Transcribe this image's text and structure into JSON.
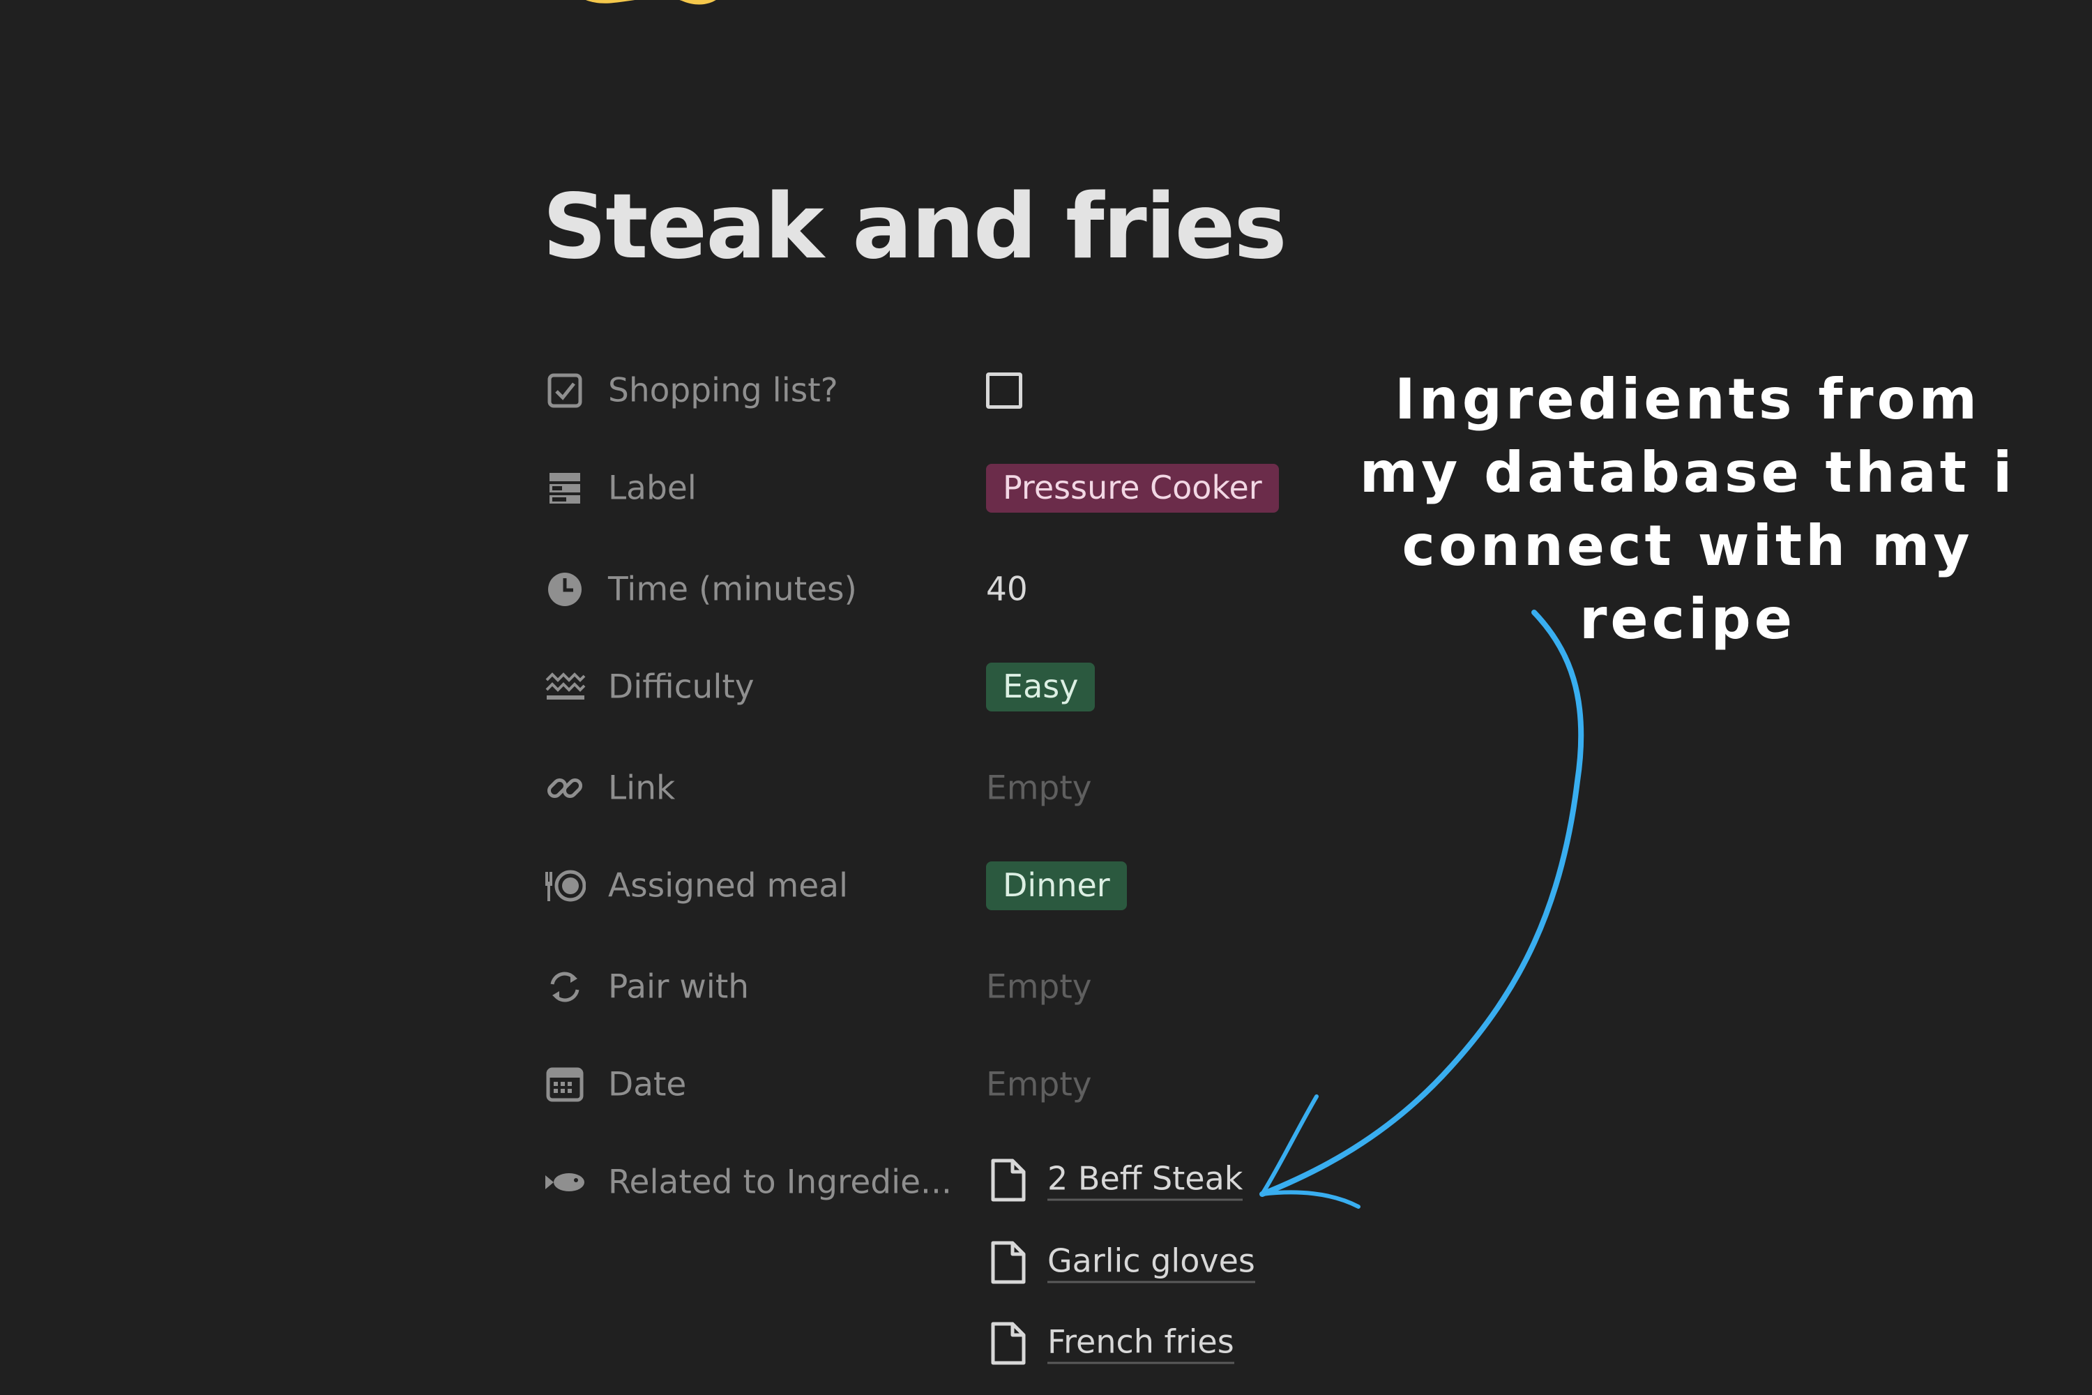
{
  "page": {
    "title": "Steak and fries",
    "icon": "food-emoji-icon"
  },
  "properties": [
    {
      "icon": "checkbox-icon",
      "label": "Shopping list?",
      "type": "checkbox",
      "checked": false
    },
    {
      "icon": "list-icon",
      "label": "Label",
      "type": "tag",
      "value": "Pressure Cooker",
      "tag_bg": "#6b2c4a",
      "tag_fg": "#f2d7e4"
    },
    {
      "icon": "clock-icon",
      "label": "Time (minutes)",
      "type": "number",
      "value": "40"
    },
    {
      "icon": "wave-icon",
      "label": "Difficulty",
      "type": "tag",
      "value": "Easy",
      "tag_bg": "#2b593f",
      "tag_fg": "#dcefe3"
    },
    {
      "icon": "link-icon",
      "label": "Link",
      "type": "empty",
      "value": "Empty"
    },
    {
      "icon": "fork-plate-icon",
      "label": "Assigned meal",
      "type": "tag",
      "value": "Dinner",
      "tag_bg": "#2b593f",
      "tag_fg": "#dcefe3"
    },
    {
      "icon": "sync-icon",
      "label": "Pair with",
      "type": "empty",
      "value": "Empty"
    },
    {
      "icon": "calendar-icon",
      "label": "Date",
      "type": "empty",
      "value": "Empty"
    },
    {
      "icon": "fish-relation-icon",
      "label": "Related to Ingredie...",
      "type": "relation"
    }
  ],
  "relations": [
    {
      "icon": "document-icon",
      "label": "2 Beff Steak"
    },
    {
      "icon": "document-icon",
      "label": "Garlic gloves"
    },
    {
      "icon": "document-icon",
      "label": "French fries"
    }
  ],
  "annotation": {
    "text": "Ingredients from my database that i connect with my recipe",
    "arrow_color": "#39aef0"
  }
}
